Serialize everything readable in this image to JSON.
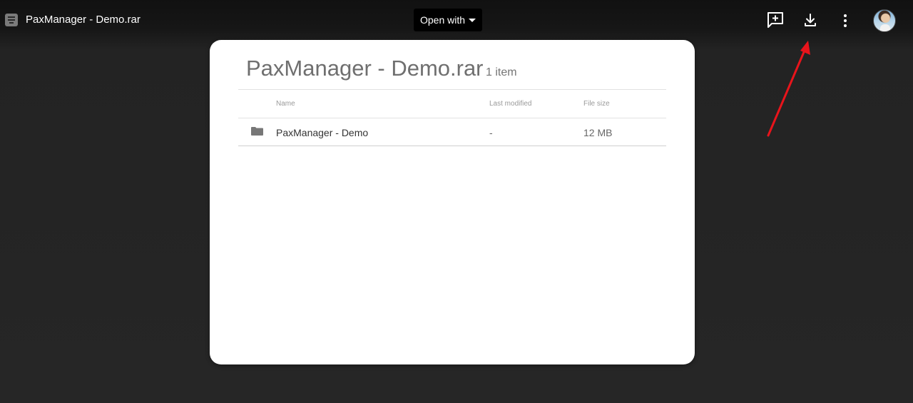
{
  "header": {
    "title": "PaxManager - Demo.rar",
    "open_with_label": "Open with",
    "icons": [
      "file-icon",
      "add-comment-icon",
      "download-icon",
      "more-vert-icon",
      "avatar"
    ]
  },
  "archive": {
    "title": "PaxManager - Demo.rar",
    "item_count": "1 item",
    "columns": {
      "name": "Name",
      "last_modified": "Last modified",
      "file_size": "File size"
    },
    "rows": [
      {
        "icon": "folder-icon",
        "name": "PaxManager - Demo",
        "last_modified": "-",
        "file_size": "12 MB"
      }
    ]
  },
  "colors": {
    "background": "#262626",
    "card": "#ffffff",
    "annotation_arrow": "#e8141b"
  }
}
